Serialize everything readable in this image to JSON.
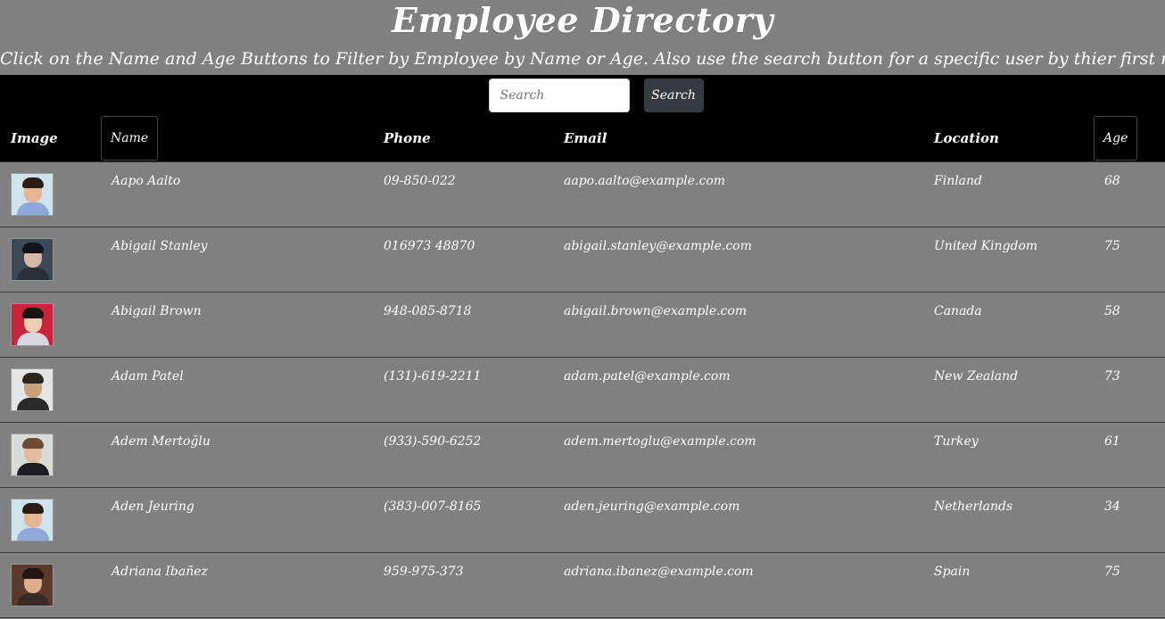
{
  "header": {
    "title": "Employee Directory",
    "subtitle": "Click on the Name and Age Buttons to Filter by Employee by Name or Age. Also use the search button for a specific user by thier first name."
  },
  "search": {
    "placeholder": "Search",
    "button_label": "Search"
  },
  "table": {
    "headers": {
      "image": "Image",
      "name": "Name",
      "phone": "Phone",
      "email": "Email",
      "location": "Location",
      "age": "Age"
    },
    "rows": [
      {
        "name": "Aapo Aalto",
        "phone": "09-850-022",
        "email": "aapo.aalto@example.com",
        "location": "Finland",
        "age": "68",
        "avatar": {
          "bg": "#cfe3ea",
          "skin": "#e6b592",
          "hair": "#2b1d14",
          "shirt": "#8fa8d8"
        }
      },
      {
        "name": "Abigail Stanley",
        "phone": "016973 48870",
        "email": "abigail.stanley@example.com",
        "location": "United Kingdom",
        "age": "75",
        "avatar": {
          "bg": "#3c4a58",
          "skin": "#d6b7a8",
          "hair": "#111418",
          "shirt": "#2a2f38"
        }
      },
      {
        "name": "Abigail Brown",
        "phone": "948-085-8718",
        "email": "abigail.brown@example.com",
        "location": "Canada",
        "age": "58",
        "avatar": {
          "bg": "#c8243e",
          "skin": "#f0cdb5",
          "hair": "#1a1512",
          "shirt": "#d8d8e0"
        }
      },
      {
        "name": "Adam Patel",
        "phone": "(131)-619-2211",
        "email": "adam.patel@example.com",
        "location": "New Zealand",
        "age": "73",
        "avatar": {
          "bg": "#e4e4e4",
          "skin": "#c9a07e",
          "hair": "#2a2520",
          "shirt": "#2a2a2a"
        }
      },
      {
        "name": "Adem Mertoğlu",
        "phone": "(933)-590-6252",
        "email": "adem.mertoglu@example.com",
        "location": "Turkey",
        "age": "61",
        "avatar": {
          "bg": "#d9dcd6",
          "skin": "#e2bb9c",
          "hair": "#6b4b34",
          "shirt": "#1e1e22"
        }
      },
      {
        "name": "Aden Jeuring",
        "phone": "(383)-007-8165",
        "email": "aden.jeuring@example.com",
        "location": "Netherlands",
        "age": "34",
        "avatar": {
          "bg": "#cfe3ea",
          "skin": "#e6b592",
          "hair": "#2b1d14",
          "shirt": "#8fa8d8"
        }
      },
      {
        "name": "Adriana Ibañez",
        "phone": "959-975-373",
        "email": "adriana.ibanez@example.com",
        "location": "Spain",
        "age": "75",
        "avatar": {
          "bg": "#5a3a2c",
          "skin": "#dcae8e",
          "hair": "#241510",
          "shirt": "#3a2a26"
        }
      }
    ]
  }
}
